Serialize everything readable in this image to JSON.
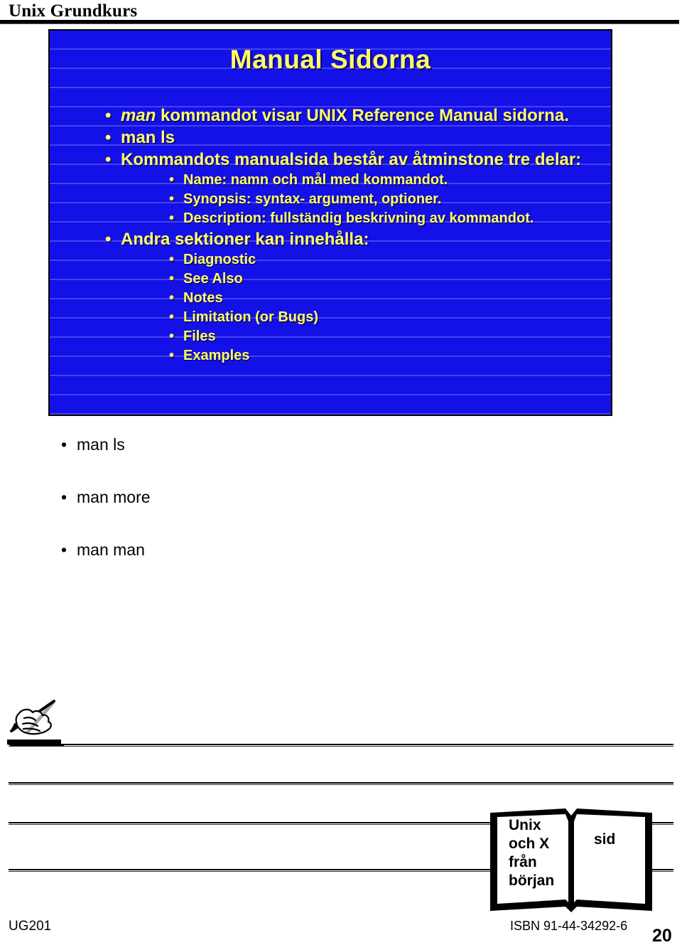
{
  "header": {
    "course_title": "Unix Grundkurs"
  },
  "slide": {
    "title": "Manual Sidorna",
    "bullets": [
      {
        "level": 1,
        "marker": "•",
        "prefix_italic": "man",
        "text": " kommandot visar UNIX Reference Manual sidorna."
      },
      {
        "level": 1,
        "marker": "•",
        "prefix_italic": "",
        "text": "man ls"
      },
      {
        "level": 1,
        "marker": "•",
        "prefix_italic": "",
        "text": "Kommandots manualsida består av åtminstone tre delar:"
      },
      {
        "level": 2,
        "marker": "•",
        "prefix_italic": "",
        "text": "Name: namn och mål med kommandot."
      },
      {
        "level": 2,
        "marker": "•",
        "prefix_italic": "",
        "text": "Synopsis: syntax- argument, optioner."
      },
      {
        "level": 2,
        "marker": "•",
        "prefix_italic": "",
        "text": "Description: fullständig beskrivning av kommandot."
      },
      {
        "level": 1,
        "marker": "•",
        "prefix_italic": "",
        "text": "Andra sektioner kan innehålla:"
      },
      {
        "level": 2,
        "marker": "•",
        "prefix_italic": "",
        "text": "Diagnostic"
      },
      {
        "level": 2,
        "marker": "•",
        "prefix_italic": "",
        "text": "See Also"
      },
      {
        "level": 2,
        "marker": "•",
        "prefix_italic": "",
        "text": "Notes"
      },
      {
        "level": 2,
        "marker": "•",
        "prefix_italic": "",
        "text": "Limitation (or Bugs)"
      },
      {
        "level": 2,
        "marker": "•",
        "prefix_italic": "",
        "text": "Files"
      },
      {
        "level": 2,
        "marker": "•",
        "prefix_italic": "",
        "text": "Examples"
      }
    ],
    "colors": {
      "background": "#1410e8",
      "text": "#ffff66",
      "border": "#000000"
    }
  },
  "notes": {
    "items": [
      {
        "marker": "•",
        "text": "man ls"
      },
      {
        "marker": "•",
        "text": "man more"
      },
      {
        "marker": "•",
        "text": "man man"
      }
    ]
  },
  "book": {
    "left_page": "Unix\noch X\nfrån\nbörjan",
    "left_page_lines": [
      "Unix",
      "och X",
      "från",
      "början"
    ],
    "right_page": "sid"
  },
  "footer": {
    "code": "UG201",
    "isbn": "ISBN 91-44-34292-6",
    "page_number": "20"
  }
}
